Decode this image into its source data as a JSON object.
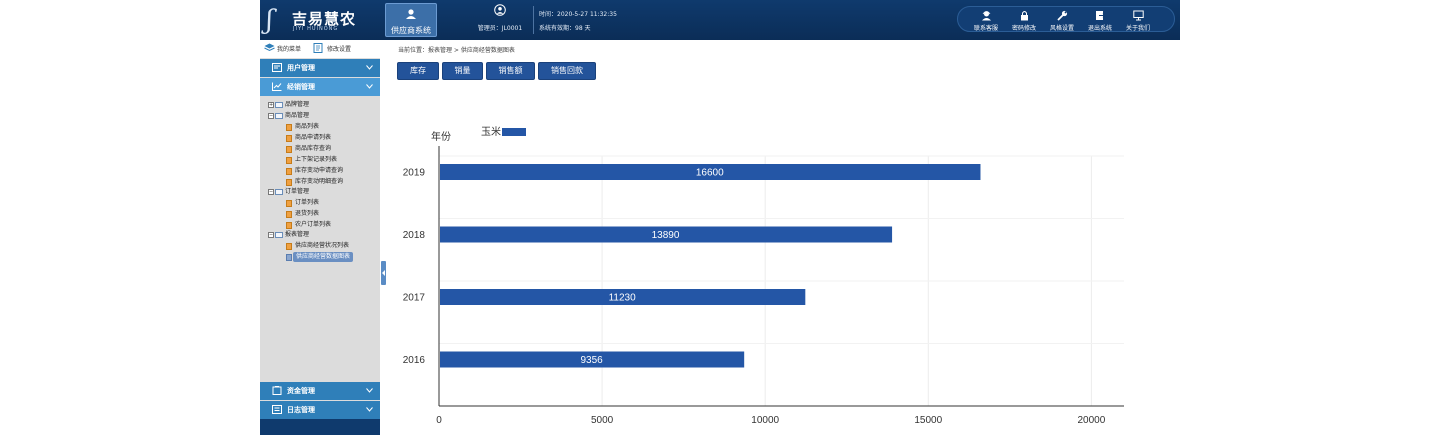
{
  "header": {
    "logo_title": "吉易慧农",
    "logo_subtitle": "JIYI HUINONG",
    "system_tab": "供应商系统",
    "admin_label": "管理员：JL0001",
    "time_label": "时间：2020-5-27 11:32:35",
    "validity_label": "系统有效期：98 天",
    "toolbar": [
      {
        "label": "联系客服",
        "icon": "customer-service-icon"
      },
      {
        "label": "密码修改",
        "icon": "lock-icon"
      },
      {
        "label": "风格设置",
        "icon": "wrench-icon"
      },
      {
        "label": "退出系统",
        "icon": "exit-icon"
      },
      {
        "label": "关于我们",
        "icon": "monitor-icon"
      }
    ]
  },
  "sidebar": {
    "my_menu": "我的菜单",
    "modify_settings": "修改设置",
    "sections": [
      {
        "label": "用户管理",
        "active": false
      },
      {
        "label": "经销管理",
        "active": true
      },
      {
        "label": "资金管理",
        "active": false
      },
      {
        "label": "日志管理",
        "active": false
      }
    ],
    "tree": [
      {
        "label": "品牌管理",
        "type": "folder",
        "expanded": false
      },
      {
        "label": "商品管理",
        "type": "folder",
        "expanded": true
      },
      {
        "label": "商品列表",
        "type": "leaf"
      },
      {
        "label": "商品申请列表",
        "type": "leaf"
      },
      {
        "label": "商品库存查询",
        "type": "leaf"
      },
      {
        "label": "上下架记录列表",
        "type": "leaf"
      },
      {
        "label": "库存变动申请查询",
        "type": "leaf"
      },
      {
        "label": "库存变动明细查询",
        "type": "leaf"
      },
      {
        "label": "订单管理",
        "type": "folder",
        "expanded": true
      },
      {
        "label": "订单列表",
        "type": "leaf"
      },
      {
        "label": "退货列表",
        "type": "leaf"
      },
      {
        "label": "农户订单列表",
        "type": "leaf"
      },
      {
        "label": "报表管理",
        "type": "folder",
        "expanded": true
      },
      {
        "label": "供应商经营状况列表",
        "type": "leaf"
      },
      {
        "label": "供应商经营数据图表",
        "type": "leaf",
        "selected": true
      }
    ]
  },
  "main": {
    "breadcrumb": "当前位置：报表管理 > 供应商经营数据图表",
    "buttons": [
      "库存",
      "销量",
      "销售额",
      "销售回款"
    ]
  },
  "colors": {
    "bar": "#2456a6",
    "header": "#0f3a6d",
    "sidebar_section": "#2f7fb9",
    "sidebar_section_active": "#4a9bd6"
  },
  "chart_data": {
    "type": "bar",
    "orientation": "horizontal",
    "categories": [
      "2019",
      "2018",
      "2017",
      "2016"
    ],
    "series": [
      {
        "name": "玉米",
        "values": [
          16600,
          13890,
          11230,
          9356
        ]
      }
    ],
    "ylabel": "年份",
    "xlim": [
      0,
      21000
    ],
    "x_ticks": [
      0,
      5000,
      10000,
      15000,
      20000
    ],
    "grid": true,
    "legend_position": "top-left",
    "data_labels": true
  }
}
